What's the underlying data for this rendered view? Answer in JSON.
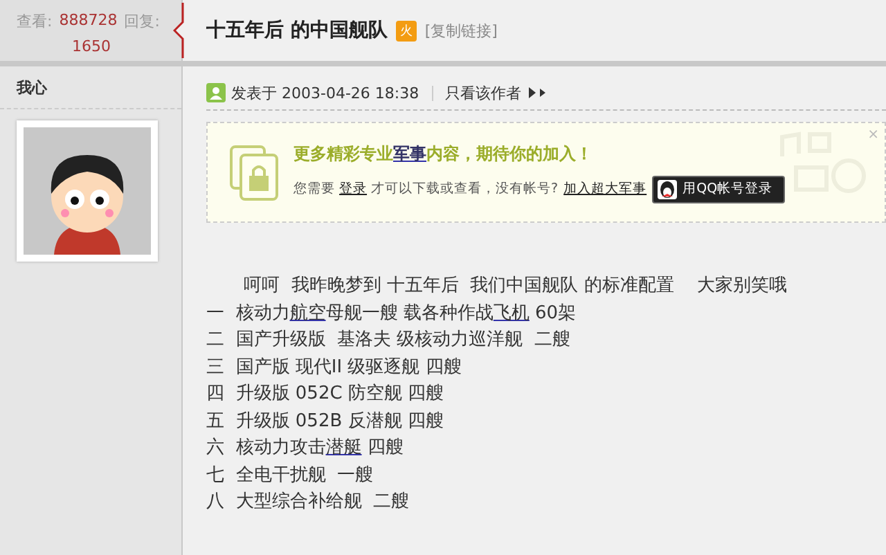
{
  "stats": {
    "views_label": "查看:",
    "views": "888728",
    "replies_label": "回复:",
    "replies": "1650"
  },
  "thread": {
    "title": "十五年后 的中国舰队",
    "badge": "火",
    "copy_link": "[复制链接]"
  },
  "author": {
    "name": "我心"
  },
  "post_meta": {
    "posted": "发表于 2003-04-26 18:38",
    "only_author": "只看该作者"
  },
  "banner": {
    "heading": [
      {
        "text": "更多精彩专业",
        "link": false
      },
      {
        "text": "军事",
        "link": true
      },
      {
        "text": "内容，期待你的加入！",
        "link": false
      }
    ],
    "prompt_before": "您需要",
    "login_link": "登录",
    "prompt_middle": "才可以下载或查看，没有帐号?",
    "register_link": "加入超大军事",
    "qq_button": "用QQ帐号登录",
    "close": "×"
  },
  "body": [
    [
      {
        "text": "呵呵  我昨晚梦到 十五年后  我们中国舰队 的标准配置    大家别笑哦",
        "link": false
      }
    ],
    [
      {
        "text": "一  核动力",
        "link": false
      },
      {
        "text": "航空",
        "link": true
      },
      {
        "text": "母舰一艘 载各种作战",
        "link": false
      },
      {
        "text": "飞机",
        "link": true
      },
      {
        "text": " 60架",
        "link": false
      }
    ],
    [
      {
        "text": "二  国产升级版  基洛夫 级核动力巡洋舰  二艘",
        "link": false
      }
    ],
    [
      {
        "text": "三  国产版 现代II 级驱逐舰 四艘",
        "link": false
      }
    ],
    [
      {
        "text": "四  升级版 052C 防空舰 四艘",
        "link": false
      }
    ],
    [
      {
        "text": "五  升级版 052B 反潜舰 四艘",
        "link": false
      }
    ],
    [
      {
        "text": "六  核动力攻击",
        "link": false
      },
      {
        "text": "潜艇",
        "link": true
      },
      {
        "text": " 四艘",
        "link": false
      }
    ],
    [
      {
        "text": "七  全电干扰舰  一艘",
        "link": false
      }
    ],
    [
      {
        "text": "八  大型综合补给舰  二艘",
        "link": false
      }
    ]
  ]
}
